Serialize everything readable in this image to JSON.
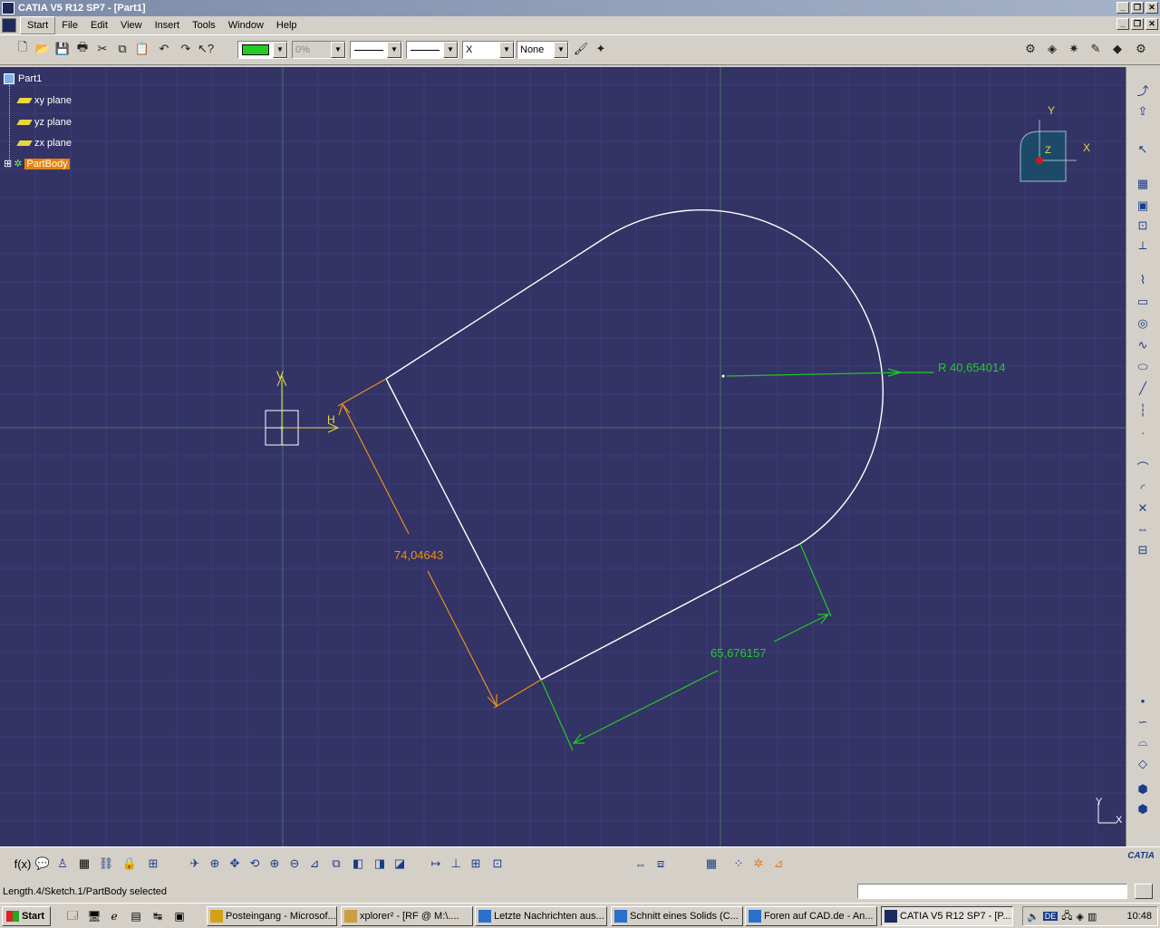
{
  "window": {
    "title": "CATIA V5 R12 SP7 - [Part1]"
  },
  "menu": {
    "items": [
      "Start",
      "File",
      "Edit",
      "View",
      "Insert",
      "Tools",
      "Window",
      "Help"
    ]
  },
  "toolbar": {
    "color_value": "",
    "transparency": "0%",
    "linetype_value": "",
    "thickness_value": "",
    "point_value": "X",
    "layer_value": "None"
  },
  "tree": {
    "root": "Part1",
    "items": [
      "xy plane",
      "yz plane",
      "zx plane"
    ],
    "selected": "PartBody"
  },
  "sketch": {
    "axis_h": "H",
    "axis_v": "V",
    "dimensions": {
      "radius": "R 40,654014",
      "length_left": "74,04643",
      "length_bottom": "65,676157"
    },
    "compass": {
      "x": "X",
      "y": "Y",
      "z": "Z"
    },
    "corner_axis": {
      "x": "X",
      "y": "Y"
    }
  },
  "colors": {
    "background": "#333366",
    "grid": "#3f3f77",
    "geometry": "#ffffff",
    "dim_green": "#22cc22",
    "dim_orange": "#e8901c",
    "axis_yellow": "#e8d840"
  },
  "statusbar": {
    "text": "Length.4/Sketch.1/PartBody selected",
    "input_value": ""
  },
  "taskbar": {
    "start": "Start",
    "tasks": [
      "Posteingang - Microsof...",
      "xplorer² - [RF @ M:\\....",
      "Letzte Nachrichten aus...",
      "Schnitt eines Solids (C...",
      "Foren auf CAD.de - An...",
      "CATIA V5 R12 SP7 - [P..."
    ],
    "tray_lang": "DE",
    "clock": "10:48"
  },
  "brand": {
    "logo": "CATIA"
  }
}
